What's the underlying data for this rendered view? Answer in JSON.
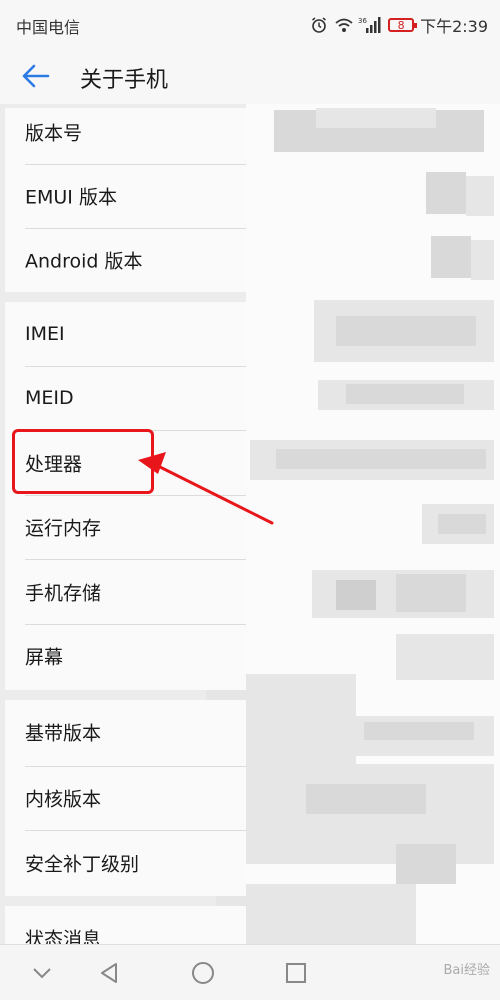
{
  "status_bar": {
    "carrier": "中国电信",
    "network": "36",
    "battery": "8",
    "time": "下午2:39"
  },
  "header": {
    "title": "关于手机"
  },
  "groups": [
    {
      "items": [
        {
          "label": "版本号"
        },
        {
          "label": "EMUI 版本"
        },
        {
          "label": "Android 版本"
        }
      ]
    },
    {
      "items": [
        {
          "label": "IMEI"
        },
        {
          "label": "MEID"
        },
        {
          "label": "处理器"
        },
        {
          "label": "运行内存"
        },
        {
          "label": "手机存储"
        },
        {
          "label": "屏幕"
        }
      ]
    },
    {
      "items": [
        {
          "label": "基带版本"
        },
        {
          "label": "内核版本"
        },
        {
          "label": "安全补丁级别"
        }
      ]
    },
    {
      "items": [
        {
          "label": "状态消息"
        }
      ]
    }
  ],
  "nav": {
    "icons": [
      "chevron-down-icon",
      "back-triangle-icon",
      "home-circle-icon",
      "recents-square-icon"
    ]
  },
  "watermark": "Bai经验",
  "colors": {
    "accent": "#2c7be5",
    "highlight": "#e8161b",
    "battery": "#d42020"
  }
}
